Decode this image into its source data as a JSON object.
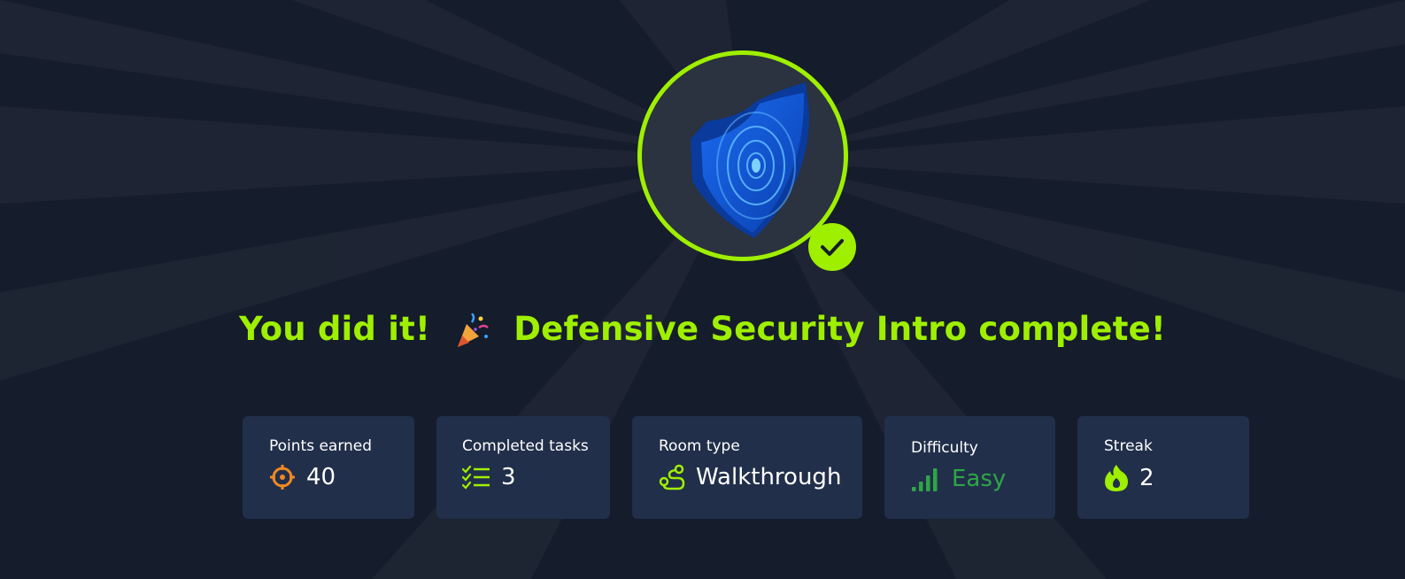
{
  "completion": {
    "headline_prefix": "You did it!",
    "headline_emoji": "party-popper-icon",
    "headline_suffix": "Defensive Security Intro complete!",
    "badge_icon": "shield-icon",
    "status_icon": "checkmark-icon"
  },
  "stats": [
    {
      "label": "Points earned",
      "value": "40",
      "icon": "target-icon",
      "icon_color": "#f08a24"
    },
    {
      "label": "Completed tasks",
      "value": "3",
      "icon": "checklist-icon",
      "icon_color": "#9fef00"
    },
    {
      "label": "Room type",
      "value": "Walkthrough",
      "icon": "route-icon",
      "icon_color": "#9fef00"
    },
    {
      "label": "Difficulty",
      "value": "Easy",
      "icon": "signal-bars-icon",
      "icon_color": "#2ea646"
    },
    {
      "label": "Streak",
      "value": "2",
      "icon": "flame-icon",
      "icon_color": "#9fef00"
    }
  ],
  "colors": {
    "accent": "#9fef00",
    "background": "#151c2b",
    "card": "#212f4a",
    "difficulty_easy": "#2ea646",
    "points": "#f08a24"
  }
}
